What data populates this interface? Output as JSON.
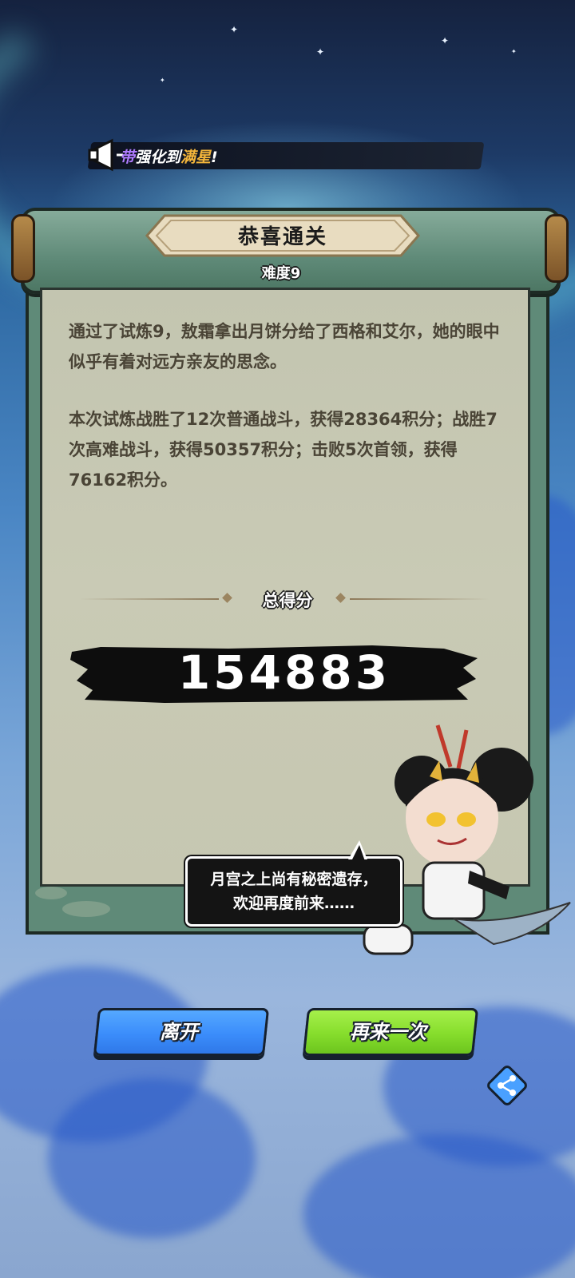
{
  "announcement": {
    "prefix": "带",
    "middle": "强化到",
    "highlight": "满星",
    "suffix": "!"
  },
  "panel": {
    "title": "恭喜通关",
    "difficulty": "难度9"
  },
  "story": {
    "paragraph_1": "通过了试炼9，敖霜拿出月饼分给了西格和艾尔，她的眼中似乎有着对远方亲友的思念。",
    "paragraph_2": "本次试炼战胜了12次普通战斗，获得28364积分；战胜7次高难战斗，获得50357积分；击败5次首领，获得76162积分。"
  },
  "score": {
    "label": "总得分",
    "value": "154883"
  },
  "speech": {
    "line_1": "月宫之上尚有秘密遗存，",
    "line_2": "欢迎再度前来……"
  },
  "buttons": {
    "leave": "离开",
    "again": "再来一次",
    "share_icon": "share-icon"
  },
  "colors": {
    "leave_button": "#3b8dfb",
    "again_button": "#86dd2c",
    "panel_frame": "#5f8a78",
    "paper": "#c6c7b1",
    "announcement_purple": "#b07cff",
    "announcement_gold": "#f4b53a"
  }
}
